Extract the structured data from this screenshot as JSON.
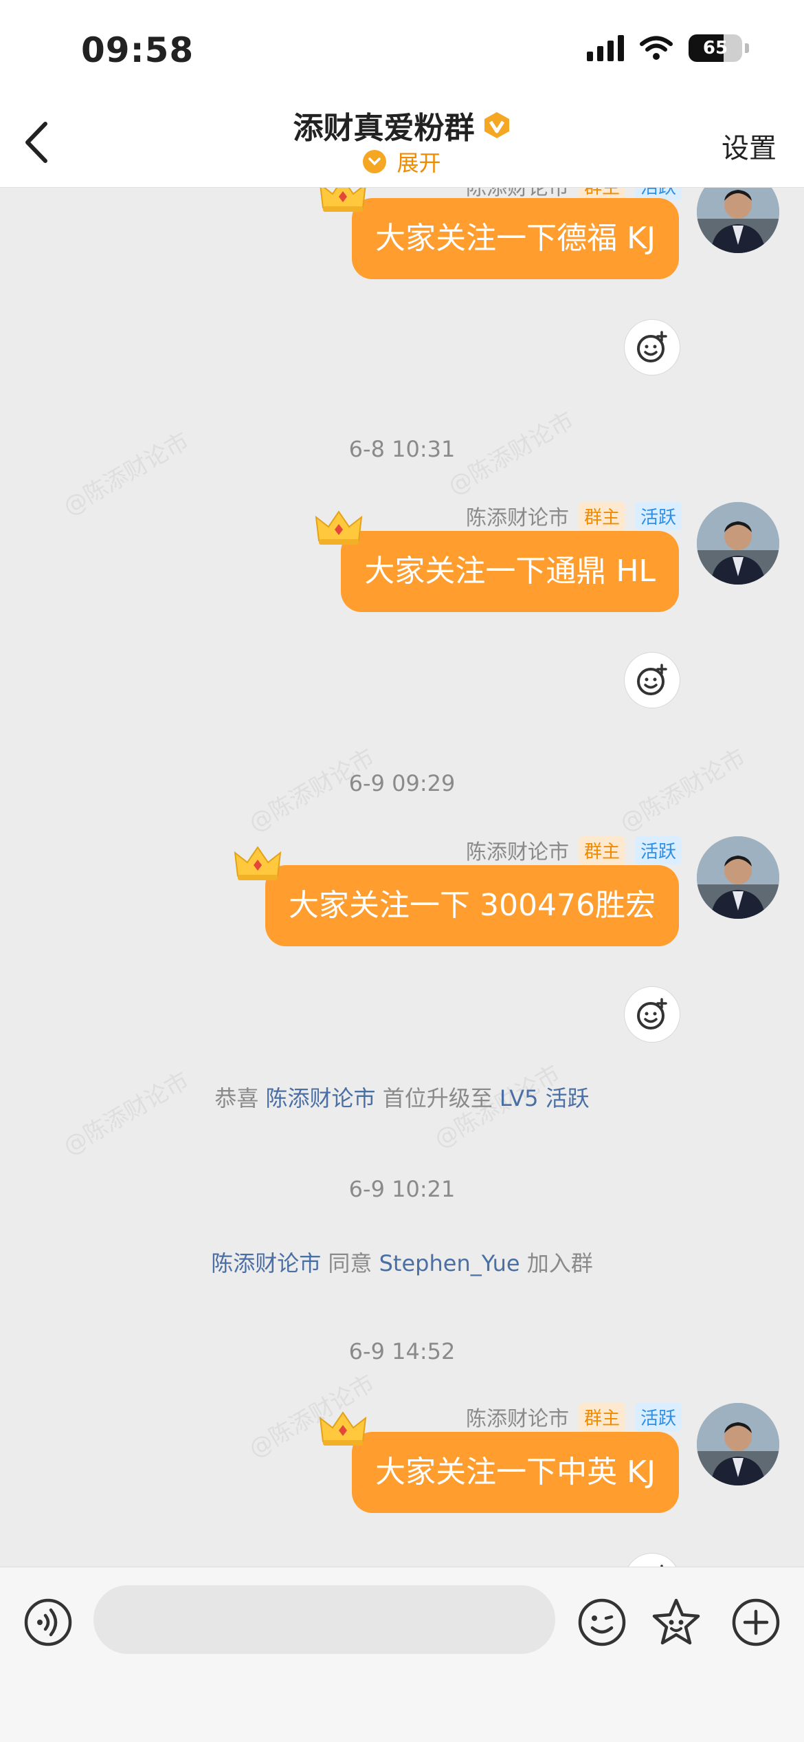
{
  "status_bar": {
    "time": "09:58",
    "battery": "65",
    "battery_level": 0.65
  },
  "header": {
    "title": "添财真爱粉群",
    "expand_label": "展开",
    "settings_label": "设置"
  },
  "watermark": "@陈添财论市",
  "sender": {
    "name": "陈添财论市",
    "owner_badge": "群主",
    "active_badge": "活跃"
  },
  "messages": [
    {
      "text": "大家关注一下德福 KJ"
    },
    {
      "text": "大家关注一下通鼎 HL"
    },
    {
      "text": "大家关注一下 300476胜宏"
    },
    {
      "text": "大家关注一下中英 KJ"
    }
  ],
  "timestamps": [
    "6-8 10:31",
    "6-9 09:29",
    "6-9 10:21",
    "6-9 14:52"
  ],
  "system_messages": {
    "upgrade": {
      "prefix": "恭喜",
      "user": "陈添财论市",
      "middle": "首位升级至",
      "level": "LV5 活跃"
    },
    "join": {
      "inviter": "陈添财论市",
      "middle": "同意",
      "joiner": "Stephen_Yue",
      "suffix": "加入群"
    }
  },
  "input": {
    "placeholder": ""
  },
  "colors": {
    "bubble": "#ff9d2e",
    "accent": "#f08a00",
    "link": "#4a6fa5",
    "active_badge": "#2b8fe8"
  },
  "icons": [
    "back-icon",
    "verified-icon",
    "chevron-down-icon",
    "crown-icon",
    "add-reaction-icon",
    "voice-icon",
    "emoji-icon",
    "sticker-icon",
    "plus-icon"
  ]
}
